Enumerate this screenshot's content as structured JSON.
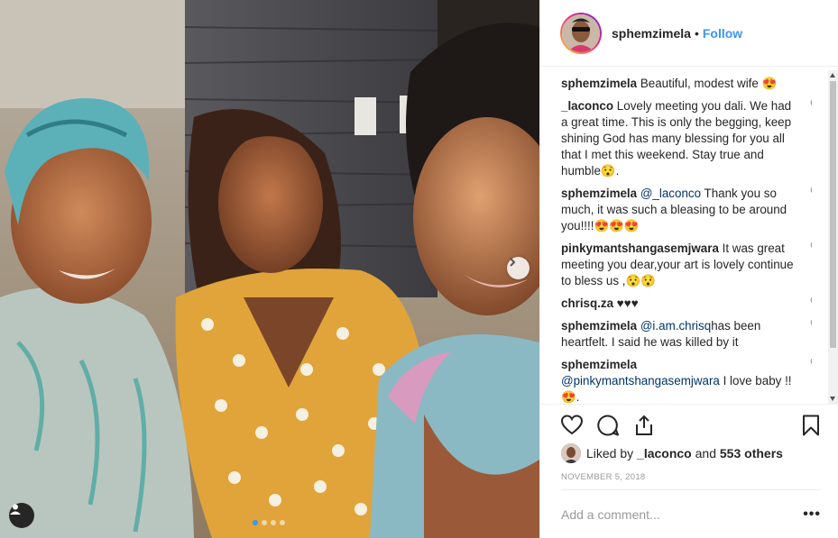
{
  "post": {
    "author": "sphemzimela",
    "separator": "•",
    "follow_label": "Follow"
  },
  "comments": [
    {
      "user": "sphemzimela",
      "parts": [
        {
          "text": "Beautiful, modest wife 😍"
        }
      ],
      "has_heart": false
    },
    {
      "user": "_laconco",
      "parts": [
        {
          "text": "Lovely meeting you dali. We had a great time. This is only the begging, keep shining God has many blessing for you all that I met this weekend. Stay true and humble😯."
        }
      ],
      "has_heart": true
    },
    {
      "user": "sphemzimela",
      "parts": [
        {
          "text": "@_laconco",
          "mention": true
        },
        {
          "text": " Thank you so much, it was such a bleasing to be around you!!!!😍😍😍"
        }
      ],
      "has_heart": true
    },
    {
      "user": "pinkymantshangasemjwara",
      "parts": [
        {
          "text": "It was great meeting you dear,your art is lovely continue to bless us ,😯😯"
        }
      ],
      "has_heart": true
    },
    {
      "user": "chrisq.za",
      "parts": [
        {
          "text": "♥♥♥"
        }
      ],
      "has_heart": true
    },
    {
      "user": "sphemzimela",
      "parts": [
        {
          "text": "@i.am.chrisq",
          "mention": true
        },
        {
          "text": "has been heartfelt. I said he was killed by it"
        }
      ],
      "has_heart": true
    },
    {
      "user": "sphemzimela",
      "parts": [
        {
          "text": "@pinkymantshangasemjwara",
          "mention": true
        },
        {
          "text": " I love baby !! 😍."
        }
      ],
      "has_heart": true,
      "user_on_own_line": true
    }
  ],
  "likes": {
    "prefix": "Liked by ",
    "user": "_laconco",
    "middle": " and ",
    "count_text": "553 others"
  },
  "date": "NOVEMBER 5, 2018",
  "add_comment": {
    "placeholder": "Add a comment...",
    "more_label": "•••"
  },
  "icons": {
    "like": "heart-outline-icon",
    "comment": "speech-bubble-icon",
    "share": "share-upload-icon",
    "save": "bookmark-icon",
    "next": "chevron-right-icon",
    "tag": "user-tag-icon"
  },
  "carousel": {
    "count": 4,
    "active_index": 0
  },
  "colors": {
    "accent": "#3897f0",
    "mention": "#003569",
    "muted": "#999999"
  }
}
